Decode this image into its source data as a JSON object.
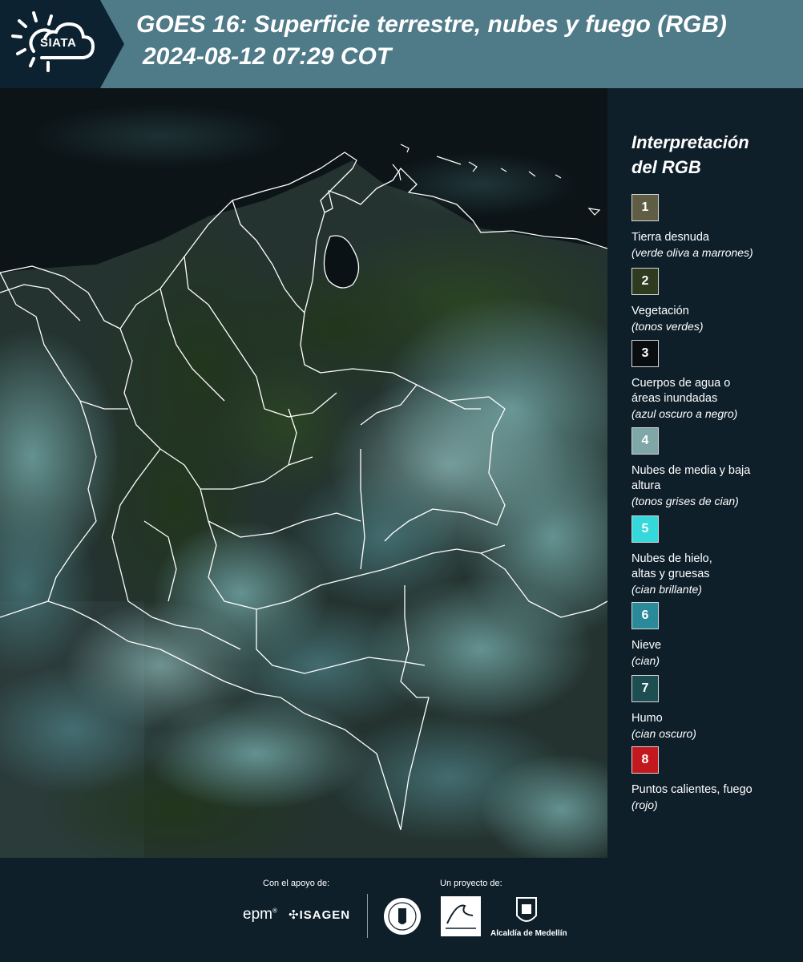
{
  "header": {
    "logo_text": "SIATA",
    "title_line1": "GOES 16: Superficie terrestre, nubes y fuego (RGB)",
    "title_line2": "2024-08-12 07:29 COT"
  },
  "legend": {
    "title_line1": "Interpretación",
    "title_line2": "del RGB",
    "items": [
      {
        "number": "1",
        "color": "#5f5e44",
        "name": "Tierra desnuda",
        "desc": "(verde oliva a marrones)"
      },
      {
        "number": "2",
        "color": "#2f3b1f",
        "name": "Vegetación",
        "desc": "(tonos verdes)"
      },
      {
        "number": "3",
        "color": "#0a0d10",
        "name": "Cuerpos de agua o áreas inundadas",
        "desc": "(azul oscuro a negro)"
      },
      {
        "number": "4",
        "color": "#7fa7a7",
        "name": "Nubes de media y baja altura",
        "desc": "(tonos grises de cian)"
      },
      {
        "number": "5",
        "color": "#35d8db",
        "name": "Nubes de hielo, altas y gruesas",
        "desc": "(cian brillante)"
      },
      {
        "number": "6",
        "color": "#2a8a9a",
        "name": "Nieve",
        "desc": "(cian)"
      },
      {
        "number": "7",
        "color": "#1c4e52",
        "name": "Humo",
        "desc": "(cian oscuro)"
      },
      {
        "number": "8",
        "color": "#c4181f",
        "name": "Puntos calientes, fuego",
        "desc": "(rojo)"
      }
    ]
  },
  "footer": {
    "support_label": "Con el apoyo de:",
    "project_label": "Un proyecto de:",
    "epm": "epm",
    "isagen": "ISAGEN",
    "medellin": "Alcaldía de Medellín"
  },
  "colors": {
    "header_bg": "#4f7a88",
    "logo_bg": "#0d2230",
    "panel_bg": "#0e1f2a",
    "border_line": "#ffffff"
  }
}
